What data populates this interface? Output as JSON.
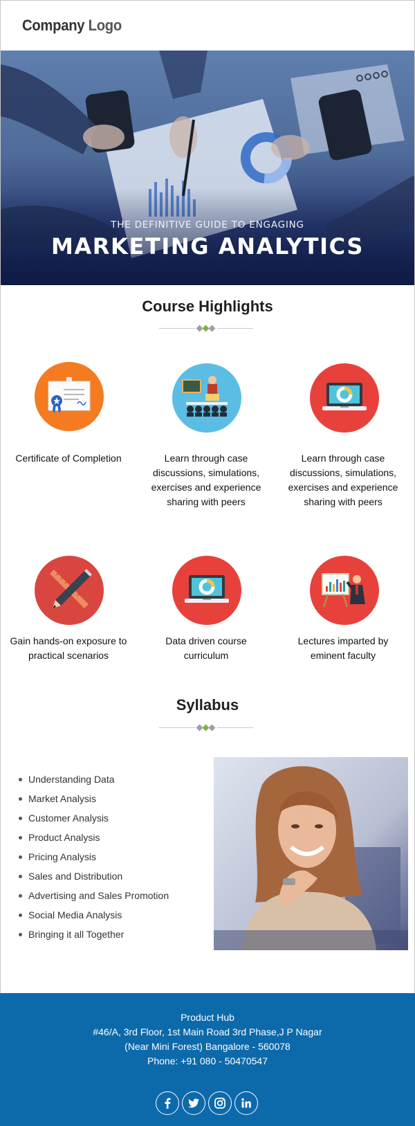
{
  "header": {
    "logo_part1": "Company",
    "logo_part2": " Logo"
  },
  "hero": {
    "subtitle": "THE DEFINITIVE GUIDE TO ENGAGING",
    "title": "MARKETING ANALYTICS"
  },
  "highlights": {
    "title": "Course Highlights",
    "items": [
      {
        "text": "Certificate of Completion",
        "icon": "certificate-icon",
        "color": "#f47b20"
      },
      {
        "text": "Learn through case discussions, simulations, exercises and experience sharing with peers",
        "icon": "presentation-audience-icon",
        "color": "#5bbde4"
      },
      {
        "text": "Learn through case discussions, simulations, exercises and experience sharing with peers",
        "icon": "laptop-chart-icon",
        "color": "#e8413b"
      },
      {
        "text": "Gain hands-on exposure to practical scenarios",
        "icon": "pencil-ruler-icon",
        "color": "#d9463f"
      },
      {
        "text": "Data driven course curriculum",
        "icon": "laptop-chart-icon",
        "color": "#e8413b"
      },
      {
        "text": "Lectures imparted by eminent faculty",
        "icon": "lecturer-board-icon",
        "color": "#e8413b"
      }
    ]
  },
  "syllabus": {
    "title": "Syllabus",
    "items": [
      "Understanding Data",
      "Market Analysis",
      "Customer Analysis",
      "Product Analysis",
      "Pricing Analysis",
      "Sales and Distribution",
      "Advertising and Sales Promotion",
      "Social Media Analysis",
      "Bringing it all Together"
    ]
  },
  "footer": {
    "name": "Product Hub",
    "address_line1": "#46/A, 3rd Floor, 1st Main Road 3rd Phase,J P Nagar",
    "address_line2": "(Near Mini Forest) Bangalore - 560078",
    "phone": "Phone: +91 080 - 50470547",
    "social": [
      "facebook-icon",
      "twitter-icon",
      "instagram-icon",
      "linkedin-icon"
    ]
  },
  "colors": {
    "footer_bg": "#0c6aab",
    "divider_grey": "#9aa0a6",
    "divider_green": "#7cb342"
  }
}
